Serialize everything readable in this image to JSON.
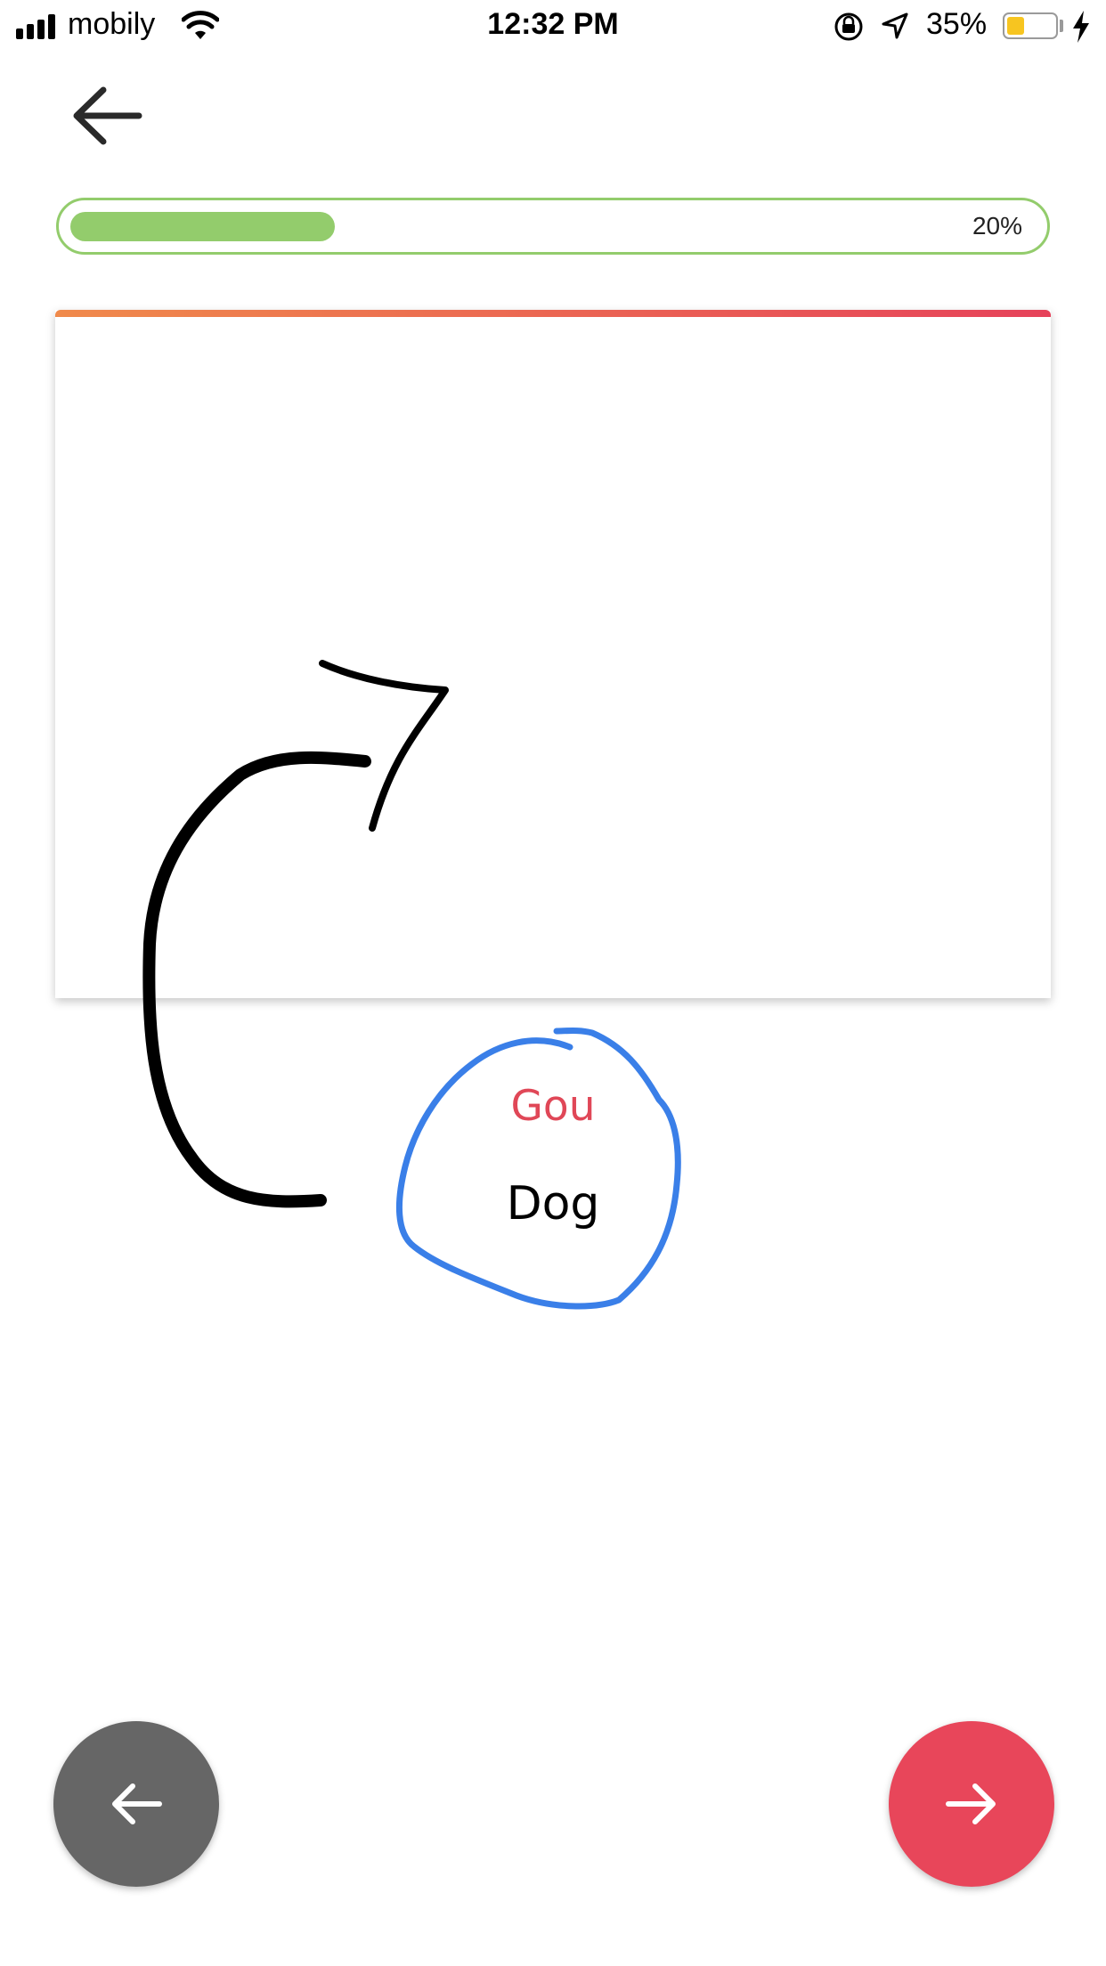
{
  "status_bar": {
    "carrier": "mobily",
    "time": "12:32 PM",
    "battery_percent": "35%",
    "battery_level": 0.35,
    "battery_color": "#f7c520",
    "icons": [
      "signal-bars-icon",
      "wifi-icon",
      "rotation-lock-icon",
      "location-arrow-icon",
      "battery-icon",
      "charging-bolt-icon"
    ]
  },
  "header": {
    "back_icon": "arrow-left-icon"
  },
  "progress": {
    "value": 0.2,
    "label": "20%",
    "color": "#93cc6c"
  },
  "card": {
    "accent_gradient": [
      "#f08a4b",
      "#e6425a"
    ]
  },
  "answer": {
    "user_answer": "Gou",
    "correct_answer": "Dog",
    "wrong_color": "#e04757"
  },
  "navigation": {
    "prev_icon": "arrow-left-icon",
    "next_icon": "arrow-right-icon",
    "prev_color": "#666666",
    "next_color": "#e8465a"
  }
}
